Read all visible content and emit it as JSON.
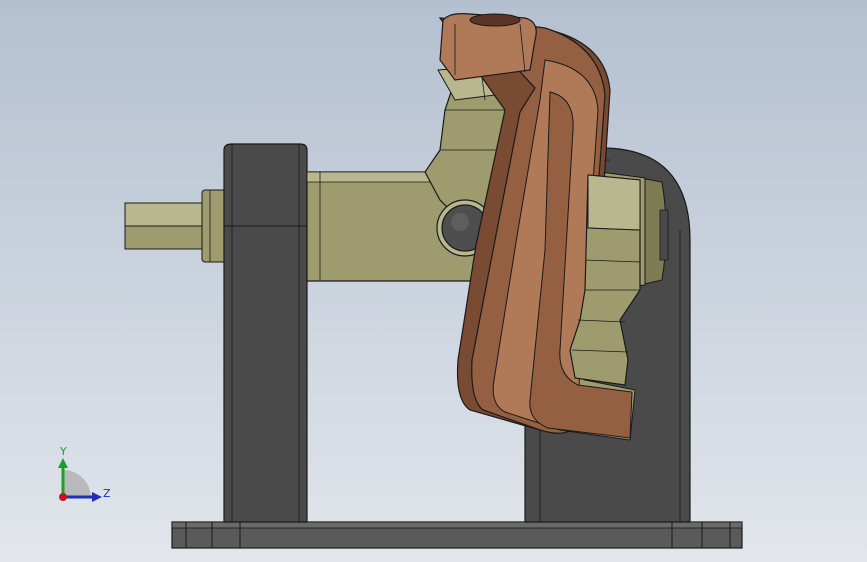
{
  "viewport": {
    "background_top": "#b4c0d0",
    "background_bottom": "#e2e6ec"
  },
  "model": {
    "colors": {
      "frame_dark": "#4a4a4a",
      "frame_mid": "#5a5a5a",
      "frame_light": "#6a6a6a",
      "edge": "#1a1a1a",
      "olive_light": "#b9b78e",
      "olive": "#9e9b6f",
      "olive_dark": "#7f7c55",
      "copper_light": "#b07a58",
      "copper": "#955f42",
      "copper_dark": "#7a4b33",
      "pin": "#4e4e4e"
    }
  },
  "triad": {
    "y_label": "Y",
    "z_label": "Z",
    "y_color": "#1e9e2a",
    "z_color": "#1f2fb8",
    "x_color": "#c8141e"
  }
}
